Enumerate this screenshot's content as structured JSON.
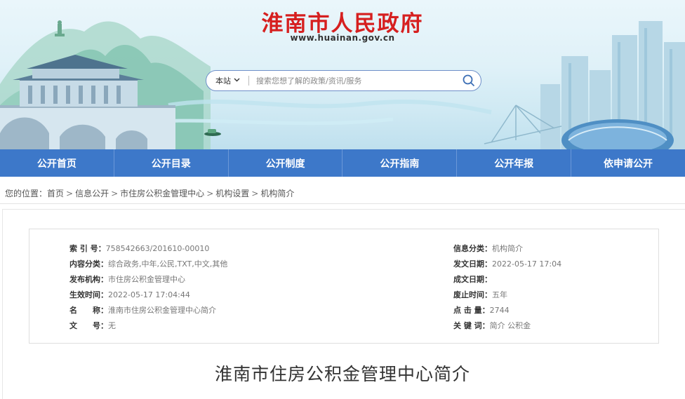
{
  "header": {
    "title": "淮南市人民政府",
    "domain": "www.huainan.gov.cn",
    "search": {
      "scope": "本站",
      "placeholder": "搜索您想了解的政策/资讯/服务"
    }
  },
  "nav": [
    {
      "label": "公开首页"
    },
    {
      "label": "公开目录"
    },
    {
      "label": "公开制度"
    },
    {
      "label": "公开指南"
    },
    {
      "label": "公开年报"
    },
    {
      "label": "依申请公开"
    }
  ],
  "breadcrumb": {
    "prefix": "您的位置：",
    "items": [
      "首页",
      "信息公开",
      "市住房公积金管理中心",
      "机构设置",
      "机构简介"
    ],
    "separator": ">"
  },
  "meta": {
    "left": [
      {
        "label": "索 引 号：",
        "value": "758542663/201610-00010"
      },
      {
        "label": "内容分类：",
        "value": "综合政务,中年,公民,TXT,中文,其他"
      },
      {
        "label": "发布机构：",
        "value": "市住房公积金管理中心"
      },
      {
        "label": "生效时间：",
        "value": "2022-05-17 17:04:44"
      },
      {
        "label": "名　　称：",
        "value": "淮南市住房公积金管理中心简介"
      },
      {
        "label": "文　　号：",
        "value": "无"
      }
    ],
    "right": [
      {
        "label": "信息分类：",
        "value": "机构简介"
      },
      {
        "label": "发文日期：",
        "value": "2022-05-17 17:04"
      },
      {
        "label": "成文日期：",
        "value": ""
      },
      {
        "label": "废止时间：",
        "value": "五年"
      },
      {
        "label": "点 击 量：",
        "value": "2744"
      },
      {
        "label": "关 键 词：",
        "value": "简介 公积金"
      }
    ]
  },
  "article": {
    "title": "淮南市住房公积金管理中心简介"
  },
  "colors": {
    "title_red": "#d61f1f",
    "nav_blue": "#3d78c9"
  }
}
